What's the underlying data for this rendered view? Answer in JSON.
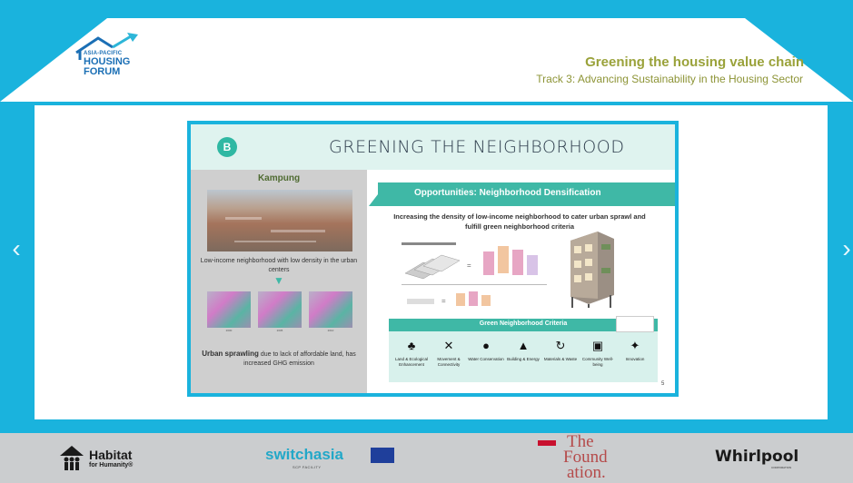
{
  "header": {
    "logo": {
      "line1": "ASIA-PACIFIC",
      "line2": "HOUSING",
      "line3": "FORUM",
      "icon": "house-arrow-logo"
    },
    "title": "Greening the housing value chain",
    "subtitle": "Track 3: Advancing Sustainability in the Housing Sector"
  },
  "nav": {
    "prev": "‹",
    "next": "›"
  },
  "slide": {
    "badge": "B",
    "title": "GREENING THE NEIGHBORHOOD",
    "left": {
      "heading": "Kampung",
      "caption1": "Low-income neighborhood with low density in the urban centers",
      "thumb_labels": [
        "2000",
        "2005",
        "2010"
      ],
      "caption2_bold": "Urban sprawling",
      "caption2_rest": " due to lack of affordable land, has increased GHG emission"
    },
    "opportunities": {
      "banner": "Opportunities: Neighborhood Densification",
      "intro": "Increasing the density of low-income neighborhood to cater urban sprawl and fulfill green neighborhood criteria"
    },
    "criteria": {
      "title": "Green Neighborhood Criteria",
      "items": [
        {
          "icon": "tree-icon",
          "glyph": "♣",
          "label": "Land & Ecological Enhancement"
        },
        {
          "icon": "arrows-icon",
          "glyph": "✕",
          "label": "Movement & Connectivity"
        },
        {
          "icon": "water-icon",
          "glyph": "●",
          "label": "Water Conservation"
        },
        {
          "icon": "building-icon",
          "glyph": "▲",
          "label": "Building & Energy"
        },
        {
          "icon": "recycle-icon",
          "glyph": "↻",
          "label": "Materials & Waste"
        },
        {
          "icon": "community-icon",
          "glyph": "▣",
          "label": "Community Well-being"
        },
        {
          "icon": "lightbulb-icon",
          "glyph": "✦",
          "label": "Innovation"
        }
      ]
    },
    "page_number": "5"
  },
  "footer": {
    "habitat": {
      "name": "Habitat",
      "sub": "for Humanity®"
    },
    "switchasia": {
      "name": "switchasia",
      "sub": "SCP FACILITY"
    },
    "hilti": {
      "name1": "The",
      "name2": "Found",
      "name3": "ation."
    },
    "whirlpool": {
      "name": "Whirlpool",
      "sub": "CORPORATION"
    }
  },
  "colors": {
    "accent": "#1ab3dd",
    "teal": "#3fb8a6",
    "olive": "#9aa23a",
    "brand_blue": "#1b6fb5"
  }
}
